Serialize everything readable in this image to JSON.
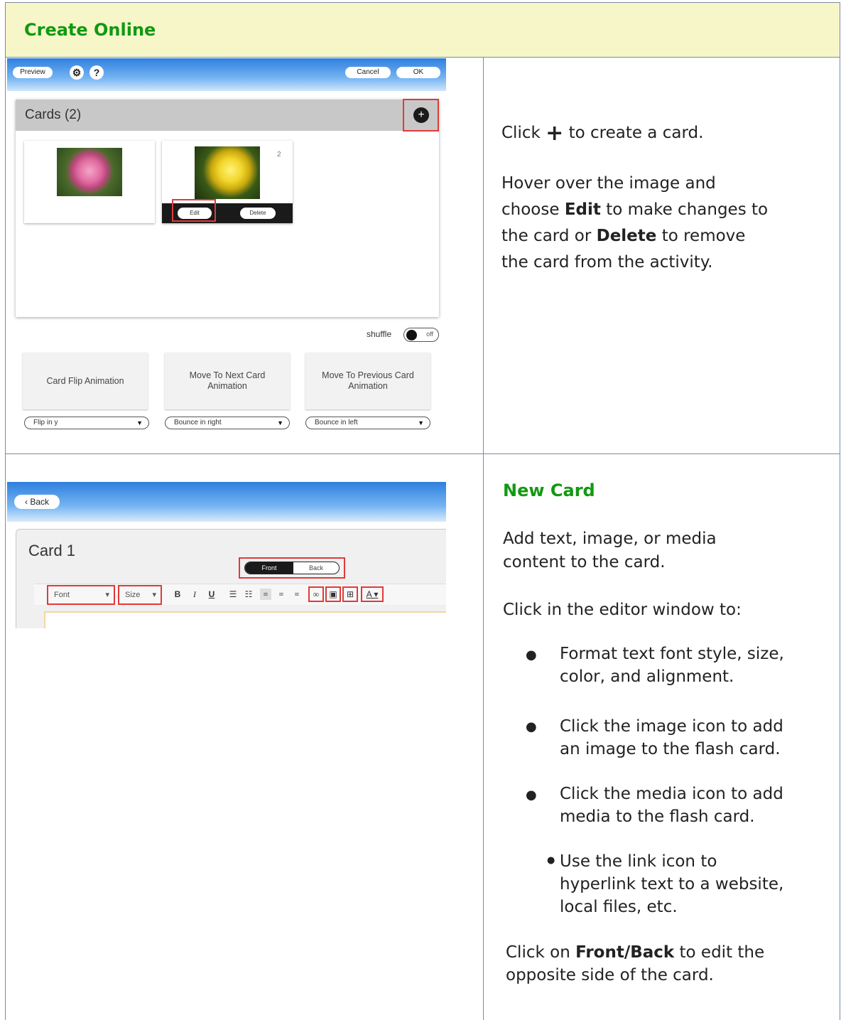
{
  "header": {
    "title": "Create Online"
  },
  "shot1": {
    "toolbar": {
      "preview": "Preview",
      "settings_icon": "gear-icon",
      "help": "?",
      "cancel": "Cancel",
      "ok": "OK"
    },
    "cards_title": "Cards (2)",
    "add_icon": "plus-icon",
    "cards": [
      {
        "image": "pink-rose",
        "number": ""
      },
      {
        "image": "yellow-rose",
        "number": "2"
      }
    ],
    "card_actions": {
      "edit": "Edit",
      "delete": "Delete"
    },
    "shuffle": {
      "label": "shuffle",
      "state": "off"
    },
    "animations": [
      {
        "label": "Card Flip Animation",
        "value": "Flip in y"
      },
      {
        "label": "Move To Next Card Animation",
        "value": "Bounce in right"
      },
      {
        "label": "Move To Previous Card Animation",
        "value": "Bounce in left"
      }
    ]
  },
  "cell1": {
    "line1_pre": "Click",
    "line1_post": "to create a card.",
    "p2_a": "Hover over the image and",
    "p2_b_pre": "choose",
    "p2_b_bold": "Edit",
    "p2_b_post": "to make changes to",
    "p2_c_pre": "the card or",
    "p2_c_bold": "Delete",
    "p2_c_post": "to remove",
    "p2_d": "the card from the activity."
  },
  "shot2": {
    "back": "Back",
    "card_name": "Card 1",
    "front": "Front",
    "back_side": "Back",
    "font": "Font",
    "size": "Size",
    "tools": [
      "B",
      "I",
      "U"
    ]
  },
  "cell2": {
    "title": "New Card",
    "p1_a": "Add text, image, or media",
    "p1_b": "content to the card.",
    "p2": "Click in the editor window to:",
    "b1_a": "Format text font style, size,",
    "b1_b": "color, and alignment.",
    "b2_a": "Click the image icon to add",
    "b2_b": "an image to the flash card.",
    "b3_a": "Click the media icon to add",
    "b3_b": "media to the flash card.",
    "b4_a": "Use the link icon to",
    "b4_b": "hyperlink text to a website,",
    "b4_c": "local files, etc.",
    "p3_pre": "Click on",
    "p3_bold": "Front/Back",
    "p3_post": "to edit the",
    "p3_b": "opposite side of the card."
  }
}
